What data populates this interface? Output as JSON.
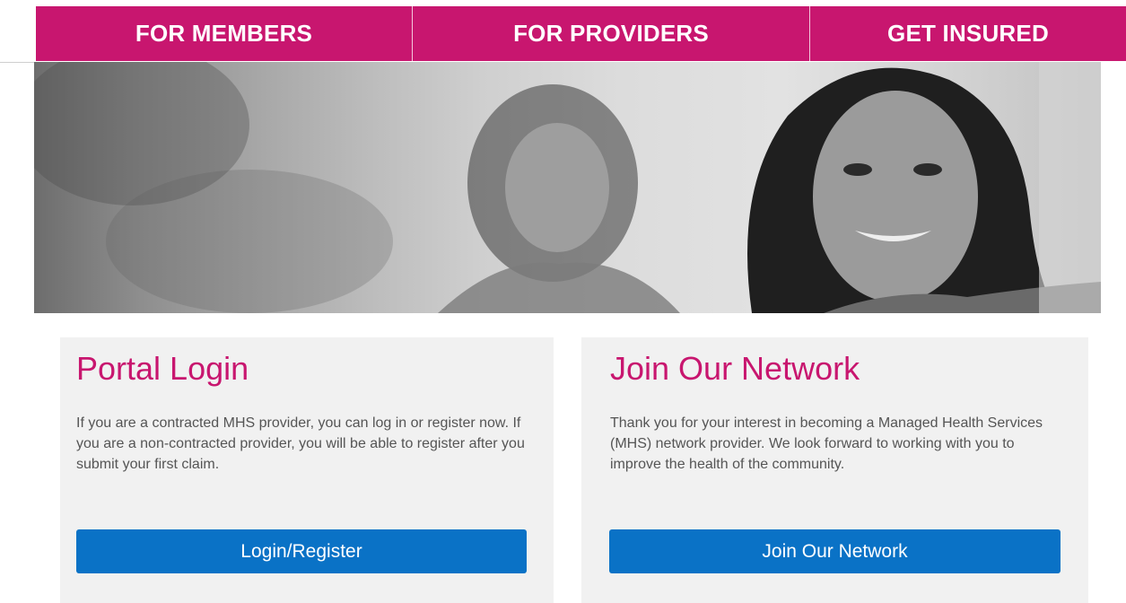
{
  "nav": {
    "items": [
      {
        "label": "FOR MEMBERS"
      },
      {
        "label": "FOR PROVIDERS"
      },
      {
        "label": "GET INSURED"
      }
    ]
  },
  "colors": {
    "brand": "#c8166f",
    "button": "#0a72c6",
    "card_bg": "#f1f1f1",
    "body_text": "#555555"
  },
  "portal_login": {
    "title": "Portal Login",
    "body": "If you are a contracted MHS provider, you can log in or register now. If you are a non-contracted provider, you will be able to register after you submit your first claim.",
    "button_label": "Login/Register"
  },
  "join_network": {
    "title": "Join Our Network",
    "body": "Thank you for your interest in becoming a Managed Health Services (MHS) network provider. We look forward to working with you to improve the health of the community.",
    "button_label": "Join Our Network"
  }
}
